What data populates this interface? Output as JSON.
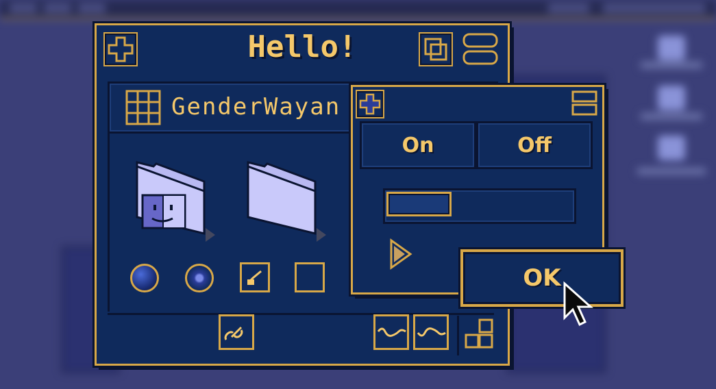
{
  "main_window": {
    "title": "Hello!",
    "path_label": "GenderWayan"
  },
  "panel": {
    "on_label": "On",
    "off_label": "Off",
    "progress": 0.35
  },
  "dialog": {
    "ok_label": "OK"
  },
  "colors": {
    "accent": "#d8a848",
    "window_bg": "#0f2a5c",
    "desktop": "#3b3f78",
    "text": "#f5c86a"
  }
}
